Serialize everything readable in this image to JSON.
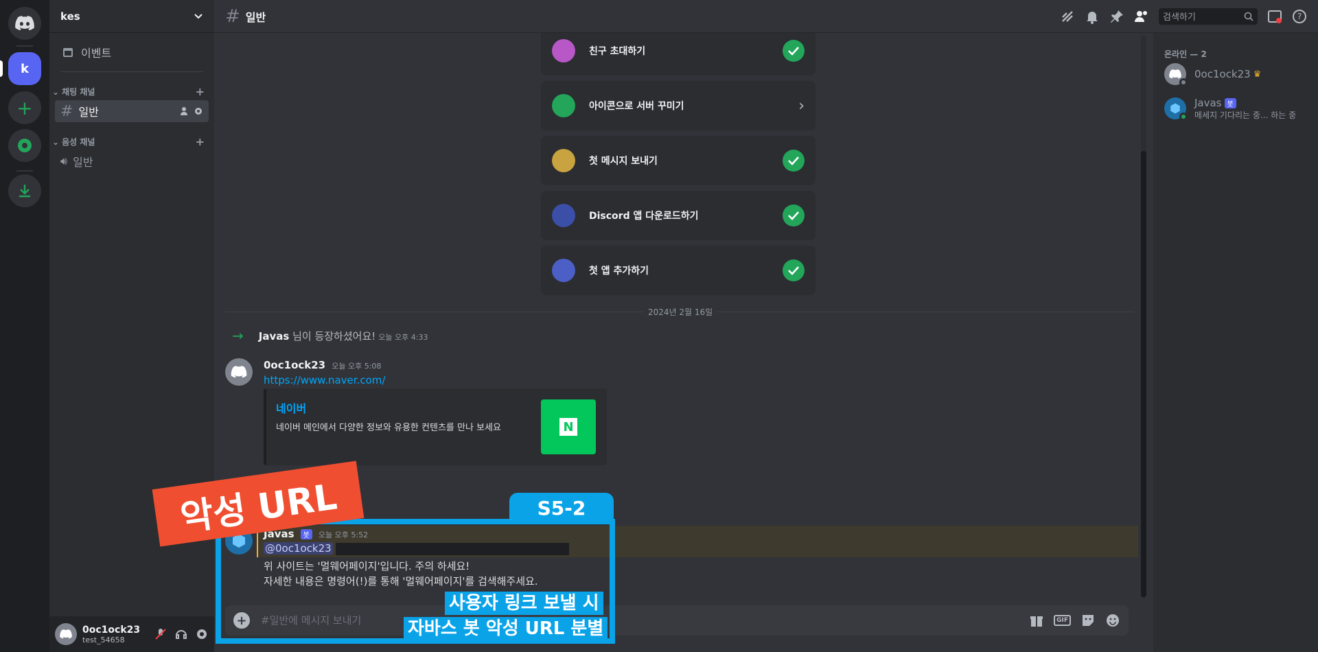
{
  "server": {
    "name": "kes",
    "icon_letter": "k"
  },
  "sidebar": {
    "events_label": "이벤트",
    "text_category": "채팅 채널",
    "voice_category": "음성 채널",
    "text_channel": "일반",
    "voice_channel": "일반"
  },
  "user": {
    "name": "0oc1ock23",
    "tag": "test_54658"
  },
  "header": {
    "channel": "일반",
    "search_placeholder": "검색하기"
  },
  "tasks": [
    {
      "label": "친구 초대하기",
      "done": true
    },
    {
      "label": "아이콘으로 서버 꾸미기",
      "done": false
    },
    {
      "label": "첫 메시지 보내기",
      "done": true
    },
    {
      "label": "Discord 앱 다운로드하기",
      "done": true
    },
    {
      "label": "첫 앱 추가하기",
      "done": true
    }
  ],
  "date_divider": "2024년 2월 16일",
  "join": {
    "user": "Javas",
    "text": "님이 등장하셨어요!",
    "time": "오늘 오후 4:33"
  },
  "msg1": {
    "author": "0oc1ock23",
    "time": "오늘 오후 5:08",
    "link": "https://www.naver.com/",
    "embed_title": "네이버",
    "embed_desc": "네이버 메인에서 다양한 정보와 유용한 컨텐츠를 만나 보세요",
    "embed_logo": "N"
  },
  "msg2": {
    "author": "Javas",
    "bot_tag": "봇",
    "time": "오늘 오후 5:52",
    "mention": "@0oc1ock23",
    "line1": "위 사이트는 '멀웨어페이지'입니다. 주의 하세요!",
    "line2": "자세한 내용은 명령어(!)를 통해 '멀웨어페이지'를 검색해주세요."
  },
  "composer": {
    "placeholder": "#일반에 메시지 보내기",
    "gif": "GIF"
  },
  "members": {
    "header": "온라인 — 2",
    "list": [
      {
        "name": "0oc1ock23",
        "owner": true
      },
      {
        "name": "Javas",
        "bot_tag": "봇",
        "status": "메세지 기다리는 중... 하는 중"
      }
    ]
  },
  "overlay": {
    "stamp": "악성 URL",
    "tag": "S5-2",
    "caption1": "사용자 링크 보낼 시",
    "caption2": "자바스 봇 악성 URL 분별"
  },
  "colors": {
    "blurple": "#5865f2",
    "green": "#23a55a",
    "overlay_blue": "#0aa3e8",
    "overlay_red": "#ef4e30"
  }
}
